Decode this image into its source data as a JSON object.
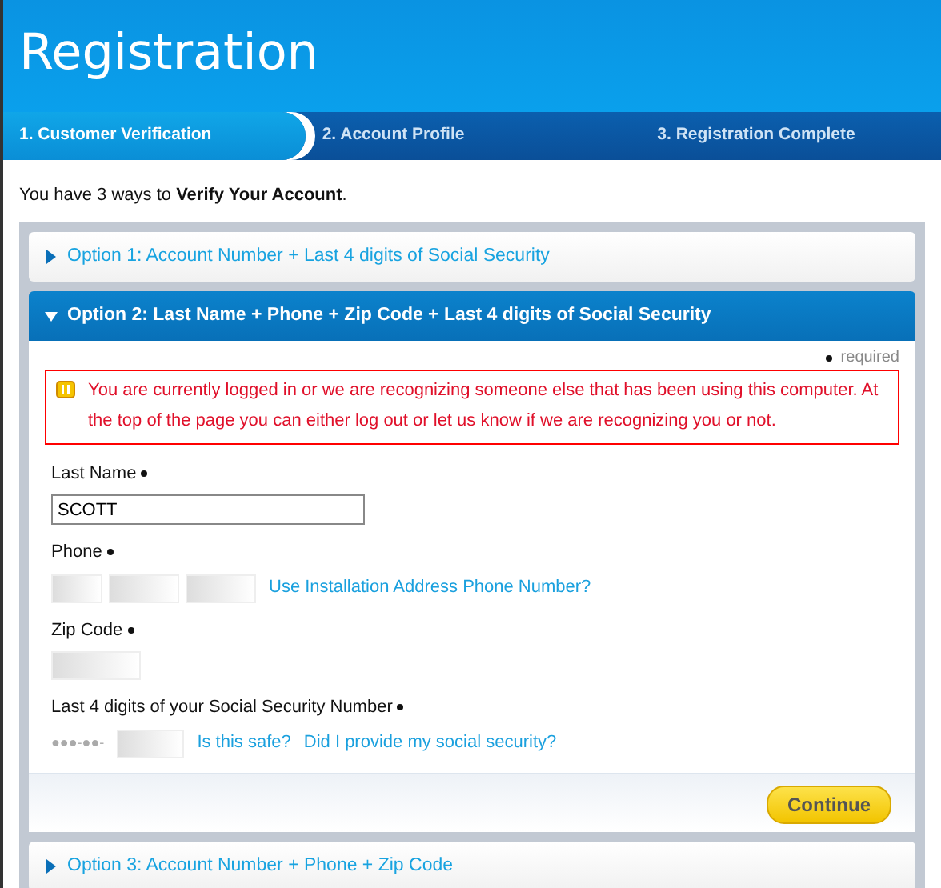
{
  "header": {
    "title": "Registration"
  },
  "steps": [
    {
      "label": "1. Customer Verification",
      "selected": true
    },
    {
      "label": "2. Account Profile",
      "selected": false
    },
    {
      "label": "3. Registration Complete",
      "selected": false
    }
  ],
  "intro": "You have 3 ways to **Verify Your Account**.",
  "options": [
    {
      "title": "Option 1: Account Number + Last 4 digits of Social Security",
      "expanded": false
    },
    {
      "title": "Option 2: Last Name + Phone + Zip Code + Last 4 digits of Social Security",
      "expanded": true,
      "required_note": "required",
      "alert": "You are currently logged in or we are recognizing someone else that has been using this computer. At the top of the page you can either log out or let us know if we are recognizing you or not.",
      "fields": [
        {
          "kind": "text",
          "label": "Last Name",
          "required": true,
          "value": "SCOTT"
        },
        {
          "kind": "phone",
          "label": "Phone",
          "required": true,
          "links": [
            "Use Installation Address Phone Number?"
          ]
        },
        {
          "kind": "zip",
          "label": "Zip Code",
          "required": true
        },
        {
          "kind": "ssn",
          "label": "Last 4 digits of your Social Security Number",
          "required": true,
          "mask": "●●●-●●-",
          "links": [
            "Is this safe?",
            "Did I provide my social security?"
          ]
        }
      ],
      "button": "Continue"
    },
    {
      "title": "Option 3: Account Number + Phone + Zip Code",
      "expanded": false
    }
  ]
}
